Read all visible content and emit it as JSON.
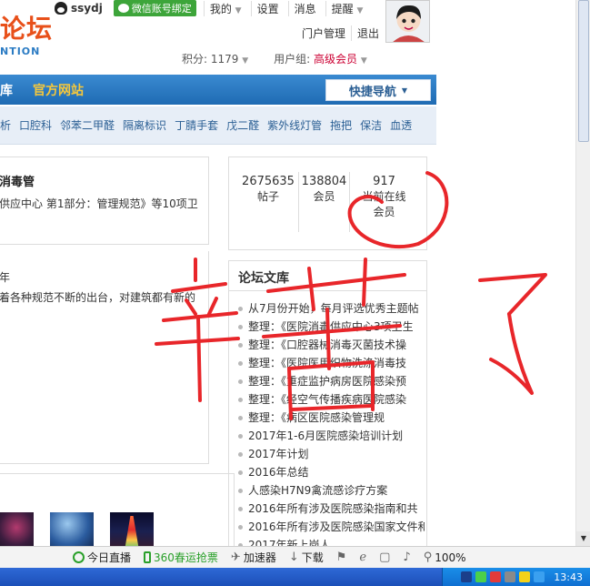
{
  "header": {
    "logo_text": "论坛",
    "logo_sub": "NTION",
    "username": "ssydj",
    "wechat_bind": "微信账号绑定",
    "top_nav": [
      "我的",
      "设置",
      "消息",
      "提醒"
    ],
    "admin_links": [
      "门户管理",
      "退出"
    ],
    "points_label": "积分: 1179",
    "usergroup_label": "用户组:",
    "usergroup_value": "高级会员"
  },
  "nav": {
    "home_fragment": "库",
    "official_site": "官方网站",
    "quick_nav": "快捷导航"
  },
  "subnav": {
    "items": [
      "析",
      "口腔科",
      "邻苯二甲醛",
      "隔离标识",
      "丁腈手套",
      "戊二醛",
      "紫外线灯管",
      "拖把",
      "保洁",
      "血透"
    ]
  },
  "left_cards": {
    "card1_title": "消毒管",
    "card1_desc": "供应中心 第1部分：管理规范》等10项卫",
    "card2_title": "年",
    "card2_desc": "着各种规范不断的出台，对建筑都有新的"
  },
  "stats": {
    "posts_value": "2675635",
    "posts_label": "帖子",
    "members_value": "138804",
    "members_label": "会员",
    "online_value": "917",
    "online_label": "当前在线会员"
  },
  "library": {
    "title": "论坛文库",
    "items": [
      "从7月份开始，每月评选优秀主题帖",
      "整理：《医院消毒供应中心3项卫生",
      "整理：《口腔器械消毒灭菌技术操",
      "整理：《医院医用织物洗涤消毒技",
      "整理：《重症监护病房医院感染预",
      "整理：《经空气传播疾病医院感染",
      "整理：《病区医院感染管理规",
      "2017年1-6月医院感染培训计划",
      "2017年计划",
      "2016年总结",
      "人感染H7N9禽流感诊疗方案",
      "2016年所有涉及医院感染指南和共",
      "2016年所有涉及医院感染国家文件和",
      "2017年新上岗人"
    ]
  },
  "statusbar": {
    "live": "今日直播",
    "ticket": "360春运抢票",
    "accelerator": "加速器",
    "download": "下载",
    "zoom": "100%"
  },
  "taskbar": {
    "clock": "13:43"
  },
  "colors": {
    "nav_blue": "#1f6bb3",
    "official_gold": "#f7c83a",
    "logo_orange": "#e8501a",
    "handwriting_red": "#e8262a"
  }
}
